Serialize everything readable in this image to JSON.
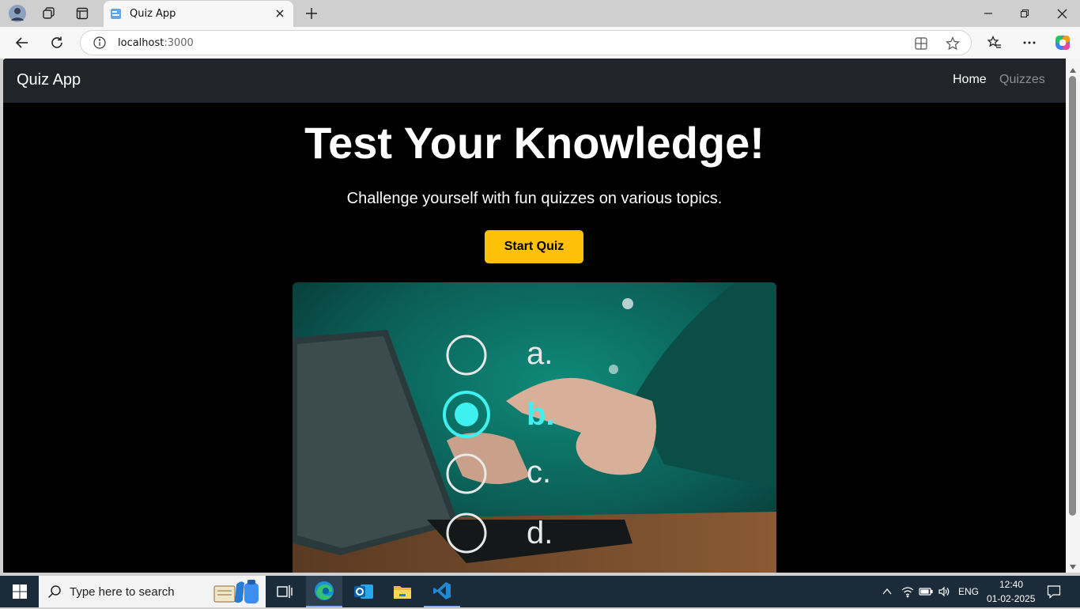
{
  "browser": {
    "tab_title": "Quiz App",
    "url_host": "localhost",
    "url_port": ":3000"
  },
  "navbar": {
    "brand": "Quiz App",
    "links": [
      "Home",
      "Quizzes"
    ]
  },
  "hero": {
    "title": "Test Your Knowledge!",
    "subtitle": "Challenge yourself with fun quizzes on various topics.",
    "button": "Start Quiz",
    "image_options": [
      "a.",
      "b.",
      "c.",
      "d."
    ]
  },
  "taskbar": {
    "search_placeholder": "Type here to search",
    "language": "ENG",
    "time": "12:40",
    "date": "01-02-2025"
  },
  "colors": {
    "accent": "#ffc107",
    "navbar_bg": "#212529",
    "page_bg": "#000000"
  }
}
